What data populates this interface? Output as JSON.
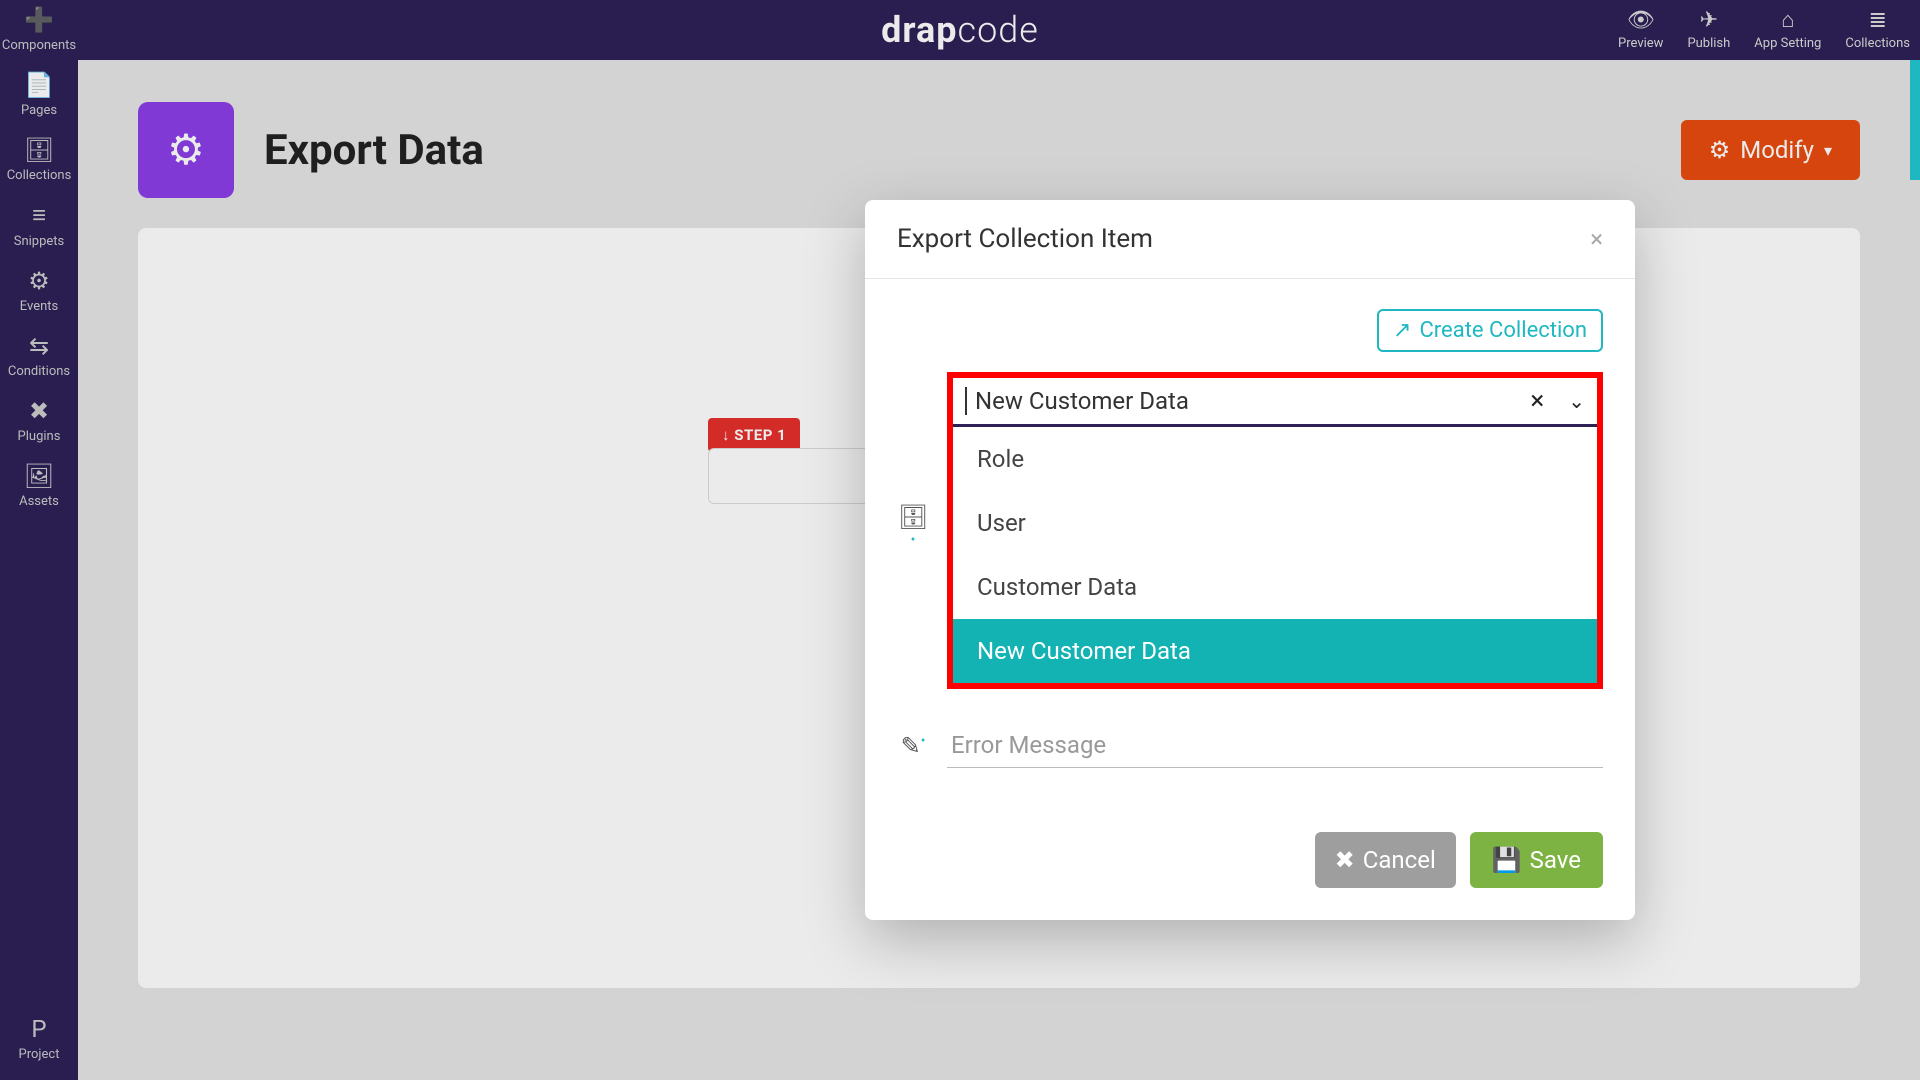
{
  "brand": {
    "a": "drap",
    "b": "code"
  },
  "topright": [
    {
      "icon": "👁",
      "label": "Preview"
    },
    {
      "icon": "✈",
      "label": "Publish"
    },
    {
      "icon": "⌂",
      "label": "App Setting"
    },
    {
      "icon": "≣",
      "label": "Collections"
    }
  ],
  "rail": [
    {
      "icon": "➕",
      "label": "Components"
    },
    {
      "icon": "📄",
      "label": "Pages"
    },
    {
      "icon": "🗄",
      "label": "Collections"
    },
    {
      "icon": "≡",
      "label": "Snippets"
    },
    {
      "icon": "⚙",
      "label": "Events"
    },
    {
      "icon": "⇆",
      "label": "Conditions"
    },
    {
      "icon": "✖",
      "label": "Plugins"
    },
    {
      "icon": "🖼",
      "label": "Assets"
    }
  ],
  "rail_bottom": {
    "icon": "P",
    "label": "Project"
  },
  "page": {
    "title": "Export Data",
    "modify": "Modify"
  },
  "step": {
    "label": "STEP 1"
  },
  "modal": {
    "title": "Export Collection Item",
    "create": "Create Collection",
    "select_value": "New Customer Data",
    "options": [
      "Role",
      "User",
      "Customer Data",
      "New Customer Data"
    ],
    "selected_index": 3,
    "error_placeholder": "Error Message",
    "cancel": "Cancel",
    "save": "Save"
  }
}
